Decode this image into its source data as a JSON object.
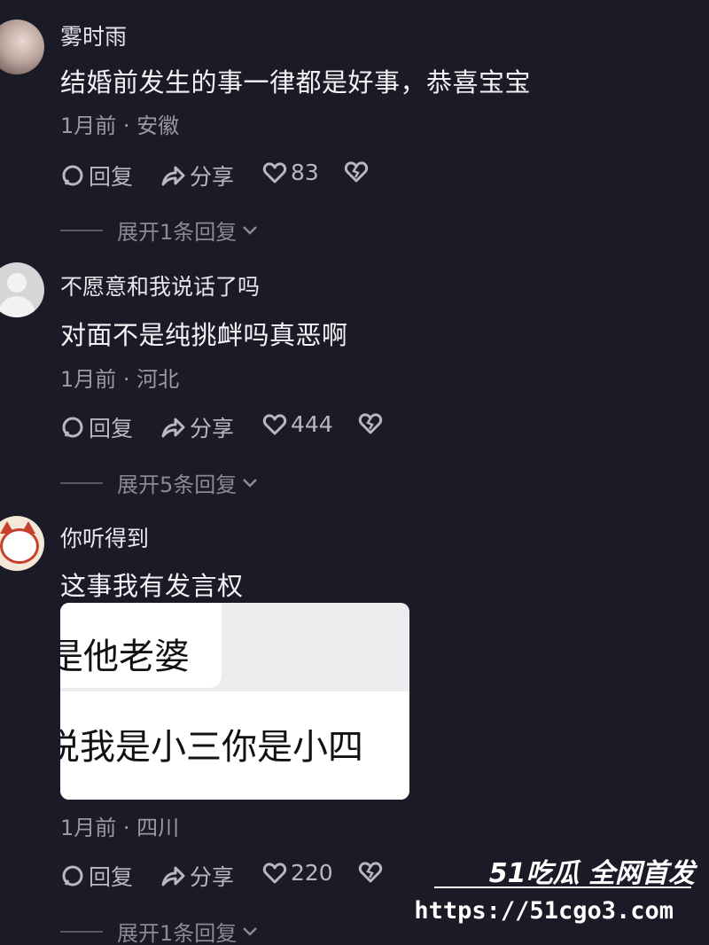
{
  "comments": [
    {
      "username": "雾时雨",
      "content": "结婚前发生的事一律都是好事，恭喜宝宝",
      "meta": "1月前 · 安徽",
      "reply_label": "回复",
      "share_label": "分享",
      "likes": "83",
      "expand_label": "展开1条回复"
    },
    {
      "username": "不愿意和我说话了吗",
      "content": "对面不是纯挑衅吗真恶啊",
      "meta": "1月前 · 河北",
      "reply_label": "回复",
      "share_label": "分享",
      "likes": "444",
      "expand_label": "展开5条回复"
    },
    {
      "username": "你听得到",
      "content": "这事我有发言权",
      "quote_line1": "是他老婆",
      "quote_line2": "说我是小三你是小四",
      "meta": "1月前 · 四川",
      "reply_label": "回复",
      "share_label": "分享",
      "likes": "220",
      "expand_label": "展开1条回复"
    }
  ],
  "watermark": {
    "brand": "51吃瓜 全网首发",
    "url": "https://51cgo3.com"
  },
  "colors": {
    "background": "#1a1b27",
    "text": "#f3f3f6",
    "muted": "#9a9aa3"
  }
}
